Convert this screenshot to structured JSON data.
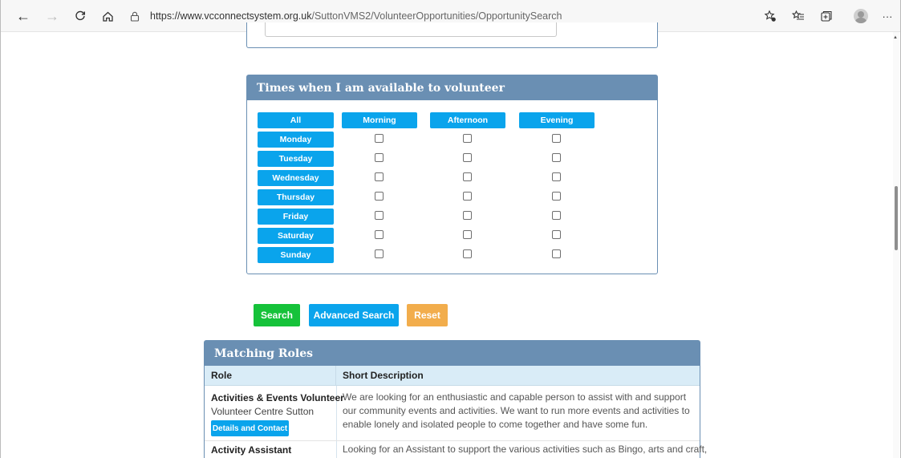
{
  "browser": {
    "url_host": "https://www.vcconnectsystem.org.uk",
    "url_path": "/SuttonVMS2/VolunteerOpportunities/OpportunitySearch",
    "menu_label": "···"
  },
  "availability": {
    "heading": "Times when I am available to volunteer",
    "all_label": "All",
    "periods": [
      "Morning",
      "Afternoon",
      "Evening"
    ],
    "days": [
      "Monday",
      "Tuesday",
      "Wednesday",
      "Thursday",
      "Friday",
      "Saturday",
      "Sunday"
    ]
  },
  "actions": {
    "search_label": "Search",
    "advanced_label": "Advanced Search",
    "reset_label": "Reset"
  },
  "roles": {
    "heading": "Matching Roles",
    "col_role": "Role",
    "col_desc": "Short Description",
    "rows": [
      {
        "title": "Activities & Events Volunteer",
        "org": "Volunteer Centre Sutton",
        "button": "Details and Contact",
        "description": "We are looking for an enthusiastic and capable person to assist with and support our community events and activities. We want to run more events and activities to enable lonely and isolated people to come together and have some fun."
      },
      {
        "title": "Activity Assistant",
        "description": "Looking for an Assistant to support the various activities such as Bingo, arts and craft,"
      }
    ]
  },
  "colors": {
    "panel_header": "#6a8fb3",
    "pill_blue": "#0aa4ec",
    "search_green": "#16c23a",
    "reset_orange": "#f2ad4c"
  }
}
